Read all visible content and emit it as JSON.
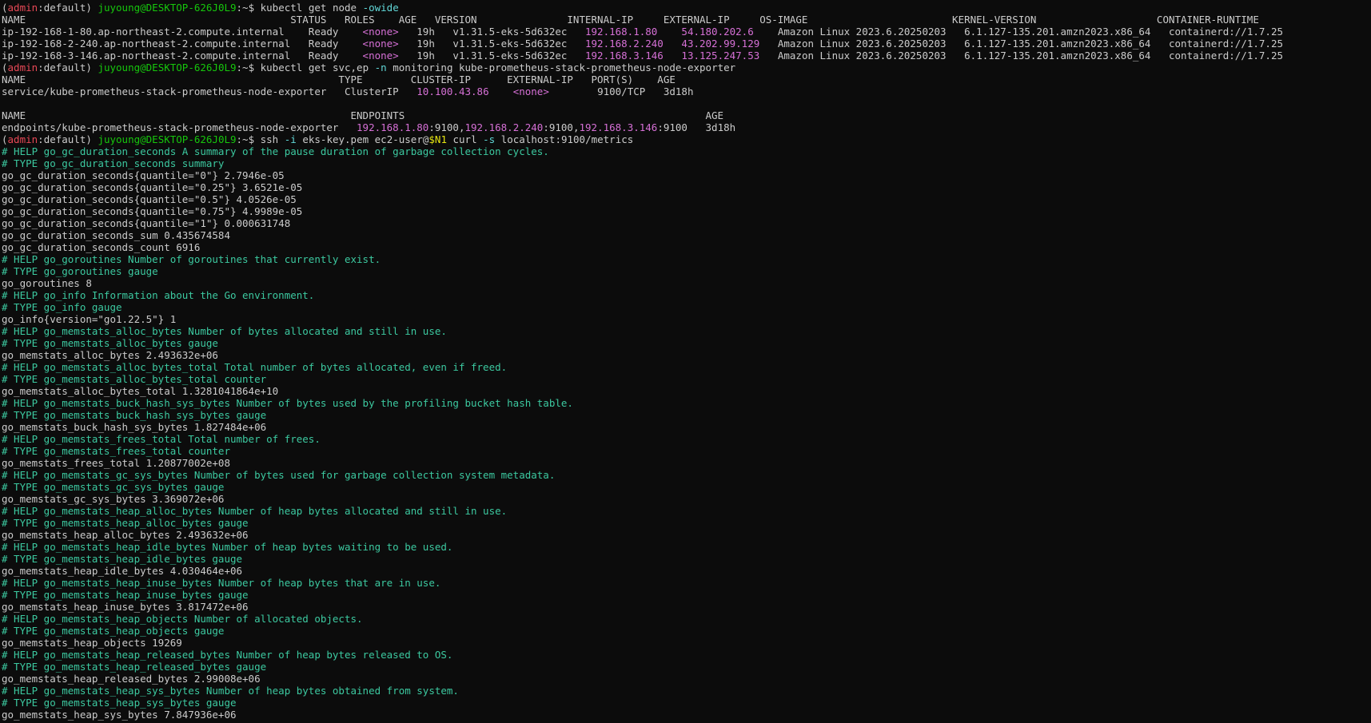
{
  "terminal": {
    "prompt_user": "juyoung@DESKTOP-626J0L9",
    "prompt_context": "admin",
    "prompt_namespace": "default",
    "lines": [
      [
        {
          "t": "(",
          "c": "white"
        },
        {
          "t": "admin",
          "c": "red"
        },
        {
          "t": ":default) ",
          "c": "white"
        },
        {
          "t": "juyoung@DESKTOP-626J0L9",
          "c": "green"
        },
        {
          "t": ":~$ kubectl get node ",
          "c": "white"
        },
        {
          "t": "-owide",
          "c": "cyan"
        }
      ],
      [
        {
          "t": "NAME                                            STATUS   ROLES    AGE   VERSION               INTERNAL-IP     EXTERNAL-IP     OS-IMAGE                        KERNEL-VERSION                    CONTAINER-RUNTIME",
          "c": "white"
        }
      ],
      [
        {
          "t": "ip-192-168-1-80.ap-northeast-2.compute.internal    Ready    ",
          "c": "white"
        },
        {
          "t": "<none>",
          "c": "magenta"
        },
        {
          "t": "   19h   v1.31.5-eks-5d632ec   ",
          "c": "white"
        },
        {
          "t": "192.168.1.80",
          "c": "magenta"
        },
        {
          "t": "    ",
          "c": "white"
        },
        {
          "t": "54.180.202.6",
          "c": "magenta"
        },
        {
          "t": "    Amazon Linux 2023.6.20250203   6.1.127-135.201.amzn2023.x86_64   containerd://1.7.25",
          "c": "white"
        }
      ],
      [
        {
          "t": "ip-192-168-2-240.ap-northeast-2.compute.internal   Ready    ",
          "c": "white"
        },
        {
          "t": "<none>",
          "c": "magenta"
        },
        {
          "t": "   19h   v1.31.5-eks-5d632ec   ",
          "c": "white"
        },
        {
          "t": "192.168.2.240",
          "c": "magenta"
        },
        {
          "t": "   ",
          "c": "white"
        },
        {
          "t": "43.202.99.129",
          "c": "magenta"
        },
        {
          "t": "   Amazon Linux 2023.6.20250203   6.1.127-135.201.amzn2023.x86_64   containerd://1.7.25",
          "c": "white"
        }
      ],
      [
        {
          "t": "ip-192-168-3-146.ap-northeast-2.compute.internal   Ready    ",
          "c": "white"
        },
        {
          "t": "<none>",
          "c": "magenta"
        },
        {
          "t": "   19h   v1.31.5-eks-5d632ec   ",
          "c": "white"
        },
        {
          "t": "192.168.3.146",
          "c": "magenta"
        },
        {
          "t": "   ",
          "c": "white"
        },
        {
          "t": "13.125.247.53",
          "c": "magenta"
        },
        {
          "t": "   Amazon Linux 2023.6.20250203   6.1.127-135.201.amzn2023.x86_64   containerd://1.7.25",
          "c": "white"
        }
      ],
      [
        {
          "t": "(",
          "c": "white"
        },
        {
          "t": "admin",
          "c": "red"
        },
        {
          "t": ":default) ",
          "c": "white"
        },
        {
          "t": "juyoung@DESKTOP-626J0L9",
          "c": "green"
        },
        {
          "t": ":~$ kubectl get svc,ep ",
          "c": "white"
        },
        {
          "t": "-n",
          "c": "cyan"
        },
        {
          "t": " monitoring kube-prometheus-stack-prometheus-node-exporter",
          "c": "white"
        }
      ],
      [
        {
          "t": "NAME                                                    TYPE        CLUSTER-IP      EXTERNAL-IP   PORT(S)    AGE",
          "c": "white"
        }
      ],
      [
        {
          "t": "service/kube-prometheus-stack-prometheus-node-exporter   ClusterIP   ",
          "c": "white"
        },
        {
          "t": "10.100.43.86",
          "c": "magenta"
        },
        {
          "t": "    ",
          "c": "white"
        },
        {
          "t": "<none>",
          "c": "magenta"
        },
        {
          "t": "        9100/TCP   3d18h",
          "c": "white"
        }
      ],
      [
        {
          "t": "",
          "c": "white"
        }
      ],
      [
        {
          "t": "NAME                                                      ENDPOINTS                                                  AGE",
          "c": "white"
        }
      ],
      [
        {
          "t": "endpoints/kube-prometheus-stack-prometheus-node-exporter   ",
          "c": "white"
        },
        {
          "t": "192.168.1.80",
          "c": "magenta"
        },
        {
          "t": ":9100,",
          "c": "white"
        },
        {
          "t": "192.168.2.240",
          "c": "magenta"
        },
        {
          "t": ":9100,",
          "c": "white"
        },
        {
          "t": "192.168.3.146",
          "c": "magenta"
        },
        {
          "t": ":9100   3d18h",
          "c": "white"
        }
      ],
      [
        {
          "t": "(",
          "c": "white"
        },
        {
          "t": "admin",
          "c": "red"
        },
        {
          "t": ":default) ",
          "c": "white"
        },
        {
          "t": "juyoung@DESKTOP-626J0L9",
          "c": "green"
        },
        {
          "t": ":~$ ssh ",
          "c": "white"
        },
        {
          "t": "-i",
          "c": "cyan"
        },
        {
          "t": " eks-key.pem ec2-user@",
          "c": "white"
        },
        {
          "t": "$N1",
          "c": "yellow"
        },
        {
          "t": " curl ",
          "c": "white"
        },
        {
          "t": "-s",
          "c": "cyan"
        },
        {
          "t": " localhost:9100/metrics",
          "c": "white"
        }
      ],
      [
        {
          "t": "# HELP go_gc_duration_seconds A summary of the pause duration of garbage collection cycles.",
          "c": "comment"
        }
      ],
      [
        {
          "t": "# TYPE go_gc_duration_seconds summary",
          "c": "comment"
        }
      ],
      [
        {
          "t": "go_gc_duration_seconds{quantile=\"0\"} 2.7946e-05",
          "c": "white"
        }
      ],
      [
        {
          "t": "go_gc_duration_seconds{quantile=\"0.25\"} 3.6521e-05",
          "c": "white"
        }
      ],
      [
        {
          "t": "go_gc_duration_seconds{quantile=\"0.5\"} 4.0526e-05",
          "c": "white"
        }
      ],
      [
        {
          "t": "go_gc_duration_seconds{quantile=\"0.75\"} 4.9989e-05",
          "c": "white"
        }
      ],
      [
        {
          "t": "go_gc_duration_seconds{quantile=\"1\"} 0.000631748",
          "c": "white"
        }
      ],
      [
        {
          "t": "go_gc_duration_seconds_sum 0.435674584",
          "c": "white"
        }
      ],
      [
        {
          "t": "go_gc_duration_seconds_count 6916",
          "c": "white"
        }
      ],
      [
        {
          "t": "# HELP go_goroutines Number of goroutines that currently exist.",
          "c": "comment"
        }
      ],
      [
        {
          "t": "# TYPE go_goroutines gauge",
          "c": "comment"
        }
      ],
      [
        {
          "t": "go_goroutines 8",
          "c": "white"
        }
      ],
      [
        {
          "t": "# HELP go_info Information about the Go environment.",
          "c": "comment"
        }
      ],
      [
        {
          "t": "# TYPE go_info gauge",
          "c": "comment"
        }
      ],
      [
        {
          "t": "go_info{version=\"go1.22.5\"} 1",
          "c": "white"
        }
      ],
      [
        {
          "t": "# HELP go_memstats_alloc_bytes Number of bytes allocated and still in use.",
          "c": "comment"
        }
      ],
      [
        {
          "t": "# TYPE go_memstats_alloc_bytes gauge",
          "c": "comment"
        }
      ],
      [
        {
          "t": "go_memstats_alloc_bytes 2.493632e+06",
          "c": "white"
        }
      ],
      [
        {
          "t": "# HELP go_memstats_alloc_bytes_total Total number of bytes allocated, even if freed.",
          "c": "comment"
        }
      ],
      [
        {
          "t": "# TYPE go_memstats_alloc_bytes_total counter",
          "c": "comment"
        }
      ],
      [
        {
          "t": "go_memstats_alloc_bytes_total 1.3281041864e+10",
          "c": "white"
        }
      ],
      [
        {
          "t": "# HELP go_memstats_buck_hash_sys_bytes Number of bytes used by the profiling bucket hash table.",
          "c": "comment"
        }
      ],
      [
        {
          "t": "# TYPE go_memstats_buck_hash_sys_bytes gauge",
          "c": "comment"
        }
      ],
      [
        {
          "t": "go_memstats_buck_hash_sys_bytes 1.827484e+06",
          "c": "white"
        }
      ],
      [
        {
          "t": "# HELP go_memstats_frees_total Total number of frees.",
          "c": "comment"
        }
      ],
      [
        {
          "t": "# TYPE go_memstats_frees_total counter",
          "c": "comment"
        }
      ],
      [
        {
          "t": "go_memstats_frees_total 1.20877002e+08",
          "c": "white"
        }
      ],
      [
        {
          "t": "# HELP go_memstats_gc_sys_bytes Number of bytes used for garbage collection system metadata.",
          "c": "comment"
        }
      ],
      [
        {
          "t": "# TYPE go_memstats_gc_sys_bytes gauge",
          "c": "comment"
        }
      ],
      [
        {
          "t": "go_memstats_gc_sys_bytes 3.369072e+06",
          "c": "white"
        }
      ],
      [
        {
          "t": "# HELP go_memstats_heap_alloc_bytes Number of heap bytes allocated and still in use.",
          "c": "comment"
        }
      ],
      [
        {
          "t": "# TYPE go_memstats_heap_alloc_bytes gauge",
          "c": "comment"
        }
      ],
      [
        {
          "t": "go_memstats_heap_alloc_bytes 2.493632e+06",
          "c": "white"
        }
      ],
      [
        {
          "t": "# HELP go_memstats_heap_idle_bytes Number of heap bytes waiting to be used.",
          "c": "comment"
        }
      ],
      [
        {
          "t": "# TYPE go_memstats_heap_idle_bytes gauge",
          "c": "comment"
        }
      ],
      [
        {
          "t": "go_memstats_heap_idle_bytes 4.030464e+06",
          "c": "white"
        }
      ],
      [
        {
          "t": "# HELP go_memstats_heap_inuse_bytes Number of heap bytes that are in use.",
          "c": "comment"
        }
      ],
      [
        {
          "t": "# TYPE go_memstats_heap_inuse_bytes gauge",
          "c": "comment"
        }
      ],
      [
        {
          "t": "go_memstats_heap_inuse_bytes 3.817472e+06",
          "c": "white"
        }
      ],
      [
        {
          "t": "# HELP go_memstats_heap_objects Number of allocated objects.",
          "c": "comment"
        }
      ],
      [
        {
          "t": "# TYPE go_memstats_heap_objects gauge",
          "c": "comment"
        }
      ],
      [
        {
          "t": "go_memstats_heap_objects 19269",
          "c": "white"
        }
      ],
      [
        {
          "t": "# HELP go_memstats_heap_released_bytes Number of heap bytes released to OS.",
          "c": "comment"
        }
      ],
      [
        {
          "t": "# TYPE go_memstats_heap_released_bytes gauge",
          "c": "comment"
        }
      ],
      [
        {
          "t": "go_memstats_heap_released_bytes 2.99008e+06",
          "c": "white"
        }
      ],
      [
        {
          "t": "# HELP go_memstats_heap_sys_bytes Number of heap bytes obtained from system.",
          "c": "comment"
        }
      ],
      [
        {
          "t": "# TYPE go_memstats_heap_sys_bytes gauge",
          "c": "comment"
        }
      ],
      [
        {
          "t": "go_memstats_heap_sys_bytes 7.847936e+06",
          "c": "white"
        }
      ]
    ]
  },
  "colors": {
    "background": "#0c0c0c",
    "foreground": "#cccccc",
    "magenta": "#d670d6",
    "green": "#16c60c",
    "cyan": "#61d6d6",
    "yellow": "#e5e510",
    "comment": "#3cc9a0",
    "red": "#e74856"
  }
}
